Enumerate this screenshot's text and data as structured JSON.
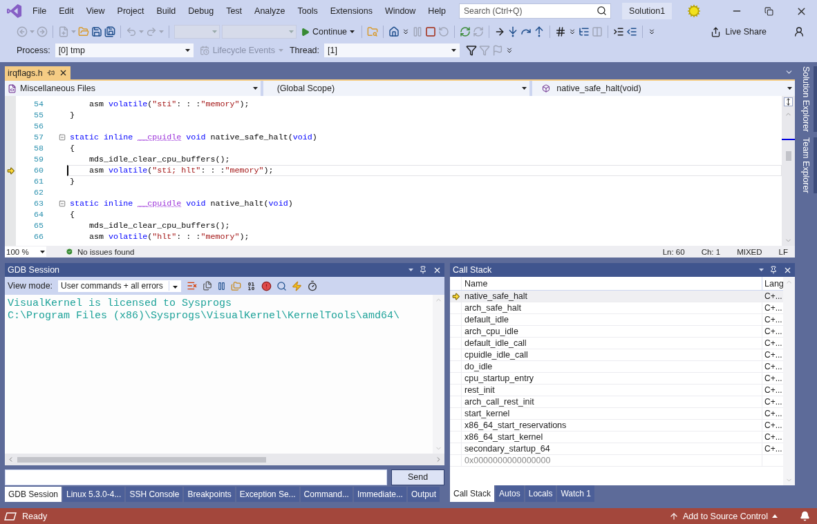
{
  "menu": [
    "File",
    "Edit",
    "View",
    "Project",
    "Build",
    "Debug",
    "Test",
    "Analyze",
    "Tools",
    "Extensions",
    "Window",
    "Help"
  ],
  "search": {
    "placeholder": "Search (Ctrl+Q)"
  },
  "solution": "Solution1",
  "toolbar": {
    "items": [
      {
        "kind": "back",
        "disabled": true
      },
      {
        "kind": "caret",
        "disabled": true
      },
      {
        "kind": "forward",
        "disabled": true
      },
      {
        "kind": "separator"
      },
      {
        "kind": "new",
        "disabled": true
      },
      {
        "kind": "caret",
        "disabled": true
      },
      {
        "kind": "open",
        "disabled": false
      },
      {
        "kind": "save",
        "disabled": false
      },
      {
        "kind": "save-all",
        "disabled": false
      },
      {
        "kind": "separator"
      },
      {
        "kind": "undo",
        "disabled": true
      },
      {
        "kind": "caret",
        "disabled": true
      },
      {
        "kind": "redo",
        "disabled": true
      },
      {
        "kind": "caret",
        "disabled": true
      },
      {
        "kind": "separator"
      },
      {
        "kind": "combo",
        "disabled": true
      },
      {
        "kind": "combo",
        "disabled": true
      },
      {
        "kind": "continue",
        "label": "Continue",
        "disabled": false
      },
      {
        "kind": "separator"
      },
      {
        "kind": "find",
        "disabled": false
      },
      {
        "kind": "separator"
      },
      {
        "kind": "home",
        "disabled": false
      },
      {
        "kind": "overflow",
        "disabled": false
      },
      {
        "kind": "pause",
        "disabled": true
      },
      {
        "kind": "stop",
        "disabled": false
      },
      {
        "kind": "restart",
        "disabled": true
      },
      {
        "kind": "separator"
      },
      {
        "kind": "refresh",
        "disabled": false
      },
      {
        "kind": "refresh",
        "disabled": true
      },
      {
        "kind": "separator"
      },
      {
        "kind": "show-next",
        "disabled": false
      },
      {
        "kind": "step-into",
        "disabled": false
      },
      {
        "kind": "step-over",
        "disabled": false
      },
      {
        "kind": "step-out",
        "disabled": false
      },
      {
        "kind": "separator"
      },
      {
        "kind": "hex",
        "disabled": false
      },
      {
        "kind": "overflow",
        "disabled": false
      },
      {
        "kind": "thread",
        "disabled": false
      },
      {
        "kind": "columns",
        "disabled": true
      },
      {
        "kind": "separator"
      },
      {
        "kind": "indent",
        "disabled": false
      },
      {
        "kind": "outdent",
        "disabled": false
      },
      {
        "kind": "separator"
      },
      {
        "kind": "overflow",
        "disabled": false
      }
    ]
  },
  "live_share": "Live Share",
  "debug_location": {
    "process_label": "Process:",
    "process": "[0] tmp",
    "lifecycle": {
      "label": "Lifecycle Events",
      "disabled": true
    },
    "thread_label": "Thread:",
    "thread": "[1]",
    "tools": [
      {
        "kind": "filter",
        "disabled": false
      },
      {
        "kind": "filter",
        "disabled": true
      },
      {
        "kind": "flag",
        "disabled": true
      },
      {
        "kind": "overflow",
        "disabled": false
      }
    ]
  },
  "editor": {
    "tab": {
      "title": "irqflags.h",
      "selected": true
    },
    "nav": {
      "project": "Miscellaneous Files",
      "scope": "(Global Scope)",
      "member": "native_safe_halt(void)"
    },
    "lines": [
      {
        "number": "54",
        "fold": false,
        "current": false,
        "tokens": [
          {
            "kind": "plain",
            "text": "    asm "
          },
          {
            "kind": "keyword",
            "text": "volatile"
          },
          {
            "kind": "plain",
            "text": "("
          },
          {
            "kind": "string",
            "text": "\"sti\""
          },
          {
            "kind": "plain",
            "text": ": : :"
          },
          {
            "kind": "string",
            "text": "\"memory\""
          },
          {
            "kind": "plain",
            "text": ");"
          }
        ]
      },
      {
        "number": "55",
        "fold": false,
        "current": false,
        "tokens": [
          {
            "kind": "plain",
            "text": "}"
          }
        ]
      },
      {
        "number": "56",
        "fold": false,
        "current": false
      },
      {
        "number": "57",
        "fold": true,
        "current": false,
        "tokens": [
          {
            "kind": "keyword",
            "text": "static "
          },
          {
            "kind": "keyword",
            "text": "inline "
          },
          {
            "kind": "macro",
            "text": "__cpuidle"
          },
          {
            "kind": "keyword",
            "text": " void"
          },
          {
            "kind": "plain",
            "text": " native_safe_halt("
          },
          {
            "kind": "keyword",
            "text": "void"
          },
          {
            "kind": "plain",
            "text": ")"
          }
        ]
      },
      {
        "number": "58",
        "fold": false,
        "current": false,
        "tokens": [
          {
            "kind": "plain",
            "text": "{"
          }
        ]
      },
      {
        "number": "59",
        "fold": false,
        "current": false,
        "tokens": [
          {
            "kind": "plain",
            "text": "    mds_idle_clear_cpu_buffers();"
          }
        ]
      },
      {
        "number": "60",
        "fold": false,
        "current": true,
        "tokens": [
          {
            "kind": "plain",
            "text": "    asm "
          },
          {
            "kind": "keyword",
            "text": "volatile"
          },
          {
            "kind": "plain",
            "text": "("
          },
          {
            "kind": "string",
            "text": "\"sti; hlt\""
          },
          {
            "kind": "plain",
            "text": ": : :"
          },
          {
            "kind": "string",
            "text": "\"memory\""
          },
          {
            "kind": "plain",
            "text": ");"
          }
        ]
      },
      {
        "number": "61",
        "fold": false,
        "current": false,
        "tokens": [
          {
            "kind": "plain",
            "text": "}"
          }
        ]
      },
      {
        "number": "62",
        "fold": false,
        "current": false
      },
      {
        "number": "63",
        "fold": true,
        "current": false,
        "tokens": [
          {
            "kind": "keyword",
            "text": "static "
          },
          {
            "kind": "keyword",
            "text": "inline "
          },
          {
            "kind": "macro",
            "text": "__cpuidle"
          },
          {
            "kind": "keyword",
            "text": " void"
          },
          {
            "kind": "plain",
            "text": " native_halt("
          },
          {
            "kind": "keyword",
            "text": "void"
          },
          {
            "kind": "plain",
            "text": ")"
          }
        ]
      },
      {
        "number": "64",
        "fold": false,
        "current": false,
        "tokens": [
          {
            "kind": "plain",
            "text": "{"
          }
        ]
      },
      {
        "number": "65",
        "fold": false,
        "current": false,
        "tokens": [
          {
            "kind": "plain",
            "text": "    mds_idle_clear_cpu_buffers();"
          }
        ]
      },
      {
        "number": "66",
        "fold": false,
        "current": false,
        "tokens": [
          {
            "kind": "plain",
            "text": "    asm "
          },
          {
            "kind": "keyword",
            "text": "volatile"
          },
          {
            "kind": "plain",
            "text": "("
          },
          {
            "kind": "string",
            "text": "\"hlt\""
          },
          {
            "kind": "plain",
            "text": ": : :"
          },
          {
            "kind": "string",
            "text": "\"memory\""
          },
          {
            "kind": "plain",
            "text": ");"
          }
        ]
      }
    ],
    "zoom": "100 %",
    "issues": "No issues found",
    "ln": "Ln: 60",
    "ch": "Ch: 1",
    "encoding": "MIXED",
    "eol": "LF"
  },
  "side_tabs": [
    "Solution Explorer",
    "Team Explorer"
  ],
  "gdb": {
    "title": "GDB Session",
    "view_mode_label": "View mode:",
    "view_mode": "User commands + all errors",
    "output": [
      "VisualKernel is licensed to Sysprogs",
      "C:\\Program Files (x86)\\Sysprogs\\VisualKernel\\KernelTools\\amd64\\"
    ],
    "send": "Send",
    "tabs": [
      {
        "label": "GDB Session",
        "selected": true
      },
      {
        "label": "Linux 5.3.0-4...",
        "selected": false
      },
      {
        "label": "SSH Console",
        "selected": false
      },
      {
        "label": "Breakpoints",
        "selected": false
      },
      {
        "label": "Exception Se...",
        "selected": false
      },
      {
        "label": "Command...",
        "selected": false
      },
      {
        "label": "Immediate...",
        "selected": false
      },
      {
        "label": "Output",
        "selected": false
      }
    ]
  },
  "call_stack": {
    "title": "Call Stack",
    "columns": [
      "Name",
      "Lang"
    ],
    "frames": [
      {
        "kind": "frame",
        "name": "native_safe_halt",
        "language": "C+...",
        "current": true
      },
      {
        "kind": "frame",
        "name": "arch_safe_halt",
        "language": "C+...",
        "current": false
      },
      {
        "kind": "frame",
        "name": "default_idle",
        "language": "C+...",
        "current": false
      },
      {
        "kind": "frame",
        "name": "arch_cpu_idle",
        "language": "C+...",
        "current": false
      },
      {
        "kind": "frame",
        "name": "default_idle_call",
        "language": "C+...",
        "current": false
      },
      {
        "kind": "frame",
        "name": "cpuidle_idle_call",
        "language": "C+...",
        "current": false
      },
      {
        "kind": "frame",
        "name": "do_idle",
        "language": "C+...",
        "current": false
      },
      {
        "kind": "frame",
        "name": "cpu_startup_entry",
        "language": "C+...",
        "current": false
      },
      {
        "kind": "frame",
        "name": "rest_init",
        "language": "C+...",
        "current": false
      },
      {
        "kind": "frame",
        "name": "arch_call_rest_init",
        "language": "C+...",
        "current": false
      },
      {
        "kind": "frame",
        "name": "start_kernel",
        "language": "C+...",
        "current": false
      },
      {
        "kind": "frame",
        "name": "x86_64_start_reservations",
        "language": "C+...",
        "current": false
      },
      {
        "kind": "frame",
        "name": "x86_64_start_kernel",
        "language": "C+...",
        "current": false
      },
      {
        "kind": "frame",
        "name": "secondary_startup_64",
        "language": "C+...",
        "current": false
      },
      {
        "kind": "address",
        "name": "0x0000000000000000",
        "current": false
      }
    ],
    "tabs": [
      {
        "label": "Call Stack",
        "selected": true
      },
      {
        "label": "Autos",
        "selected": false
      },
      {
        "label": "Locals",
        "selected": false
      },
      {
        "label": "Watch 1",
        "selected": false
      }
    ]
  },
  "status_bar": {
    "text": "Ready",
    "source_control": "Add to Source Control"
  }
}
